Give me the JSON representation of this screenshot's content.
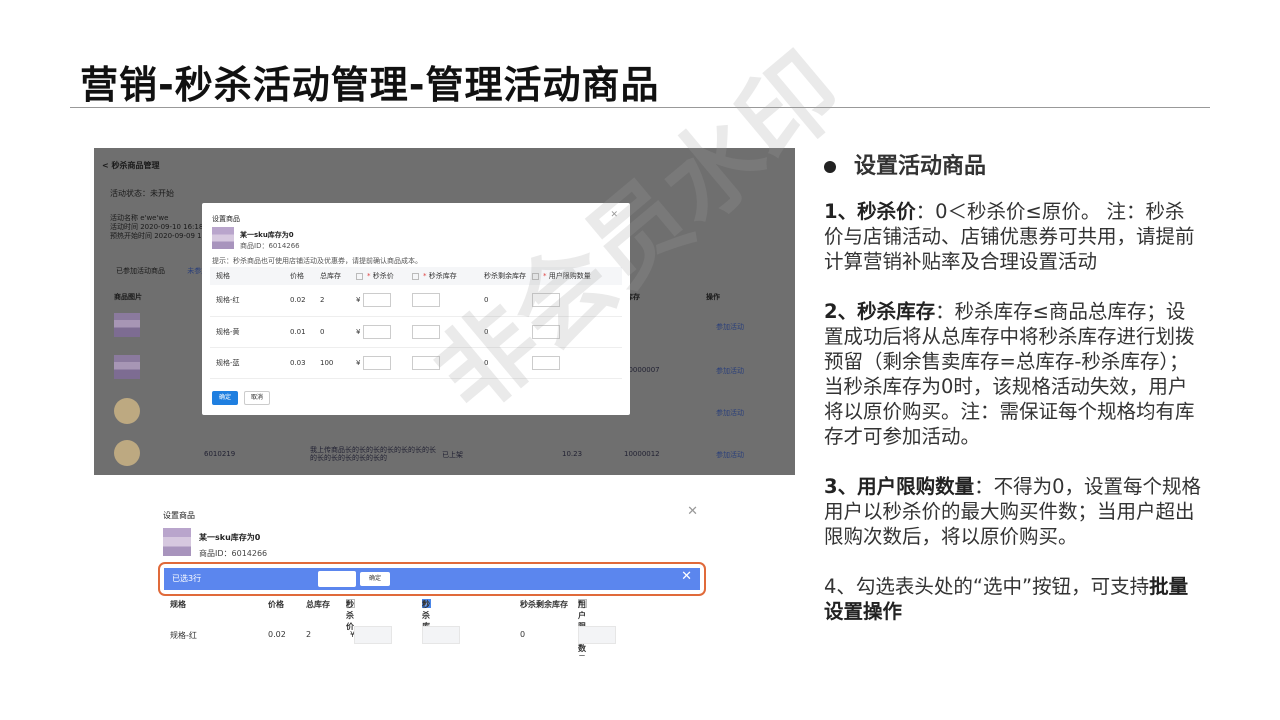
{
  "page_title": "营销-秒杀活动管理-管理活动商品",
  "watermark": "非会员水印",
  "top_screenshot": {
    "back_title": "< 秒杀商品管理",
    "status": "活动状态：未开始",
    "info": [
      "活动名称  e'we'we",
      "活动时间  2020-09-10 16:18",
      "预热开始时间  2020-09-09 16:19"
    ],
    "tabs": [
      "已参加活动商品",
      "未参加商品"
    ],
    "bg_headers": [
      "商品图片",
      "库存",
      "操作"
    ],
    "bg_rows": [
      {
        "id": "",
        "desc": "",
        "status": "",
        "price": "",
        "stock": "",
        "action": "参加活动"
      },
      {
        "id": "",
        "desc": "",
        "status": "",
        "price": "",
        "stock": "10000007",
        "action": "参加活动"
      },
      {
        "id": "",
        "desc": "",
        "status": "",
        "price": "",
        "stock": "",
        "action": "参加活动"
      },
      {
        "id": "6010219",
        "desc": "我上传商品长的长的长的长的长的长的长的长的长的长的长的长的",
        "status": "已上架",
        "price": "10.23",
        "stock": "10000012",
        "action": "参加活动"
      }
    ],
    "dialog": {
      "title": "设置商品",
      "product_name": "某一sku库存为0",
      "product_id": "商品ID：6014266",
      "tip": "提示：秒杀商品也可使用店铺活动及优惠券，请提前确认商品成本。",
      "headers": [
        "规格",
        "价格",
        "总库存",
        "秒杀价",
        "秒杀库存",
        "秒杀剩余库存",
        "用户限购数量"
      ],
      "rows": [
        {
          "spec": "规格-红",
          "price": "0.02",
          "stock": "2",
          "currency": "¥",
          "remain": "0"
        },
        {
          "spec": "规格-黄",
          "price": "0.01",
          "stock": "0",
          "currency": "¥",
          "remain": "0"
        },
        {
          "spec": "规格-蓝",
          "price": "0.03",
          "stock": "100",
          "currency": "¥",
          "remain": "0"
        }
      ],
      "ok": "确定",
      "cancel": "取消"
    }
  },
  "bottom_screenshot": {
    "title": "设置商品",
    "product_name": "某一sku库存为0",
    "product_id": "商品ID：6014266",
    "selected_count": "已选3行",
    "bar_ok": "确定",
    "headers": [
      "规格",
      "价格",
      "总库存",
      "秒杀价",
      "秒杀库存",
      "秒杀剩余库存",
      "用户限购数量"
    ],
    "row": {
      "spec": "规格-红",
      "price": "0.02",
      "stock": "2",
      "currency": "¥",
      "remain": "0"
    }
  },
  "notes": {
    "heading": "设置活动商品",
    "p1_bold": "1、秒杀价",
    "p1_text": "：0＜秒杀价≤原价。 注：秒杀价与店铺活动、店铺优惠券可共用，请提前计算营销补贴率及合理设置活动",
    "p2_bold": "2、秒杀库存",
    "p2_text": "：秒杀库存≤商品总库存；设置成功后将从总库存中将秒杀库存进行划拨预留（剩余售卖库存=总库存-秒杀库存）；当秒杀库存为0时，该规格活动失效，用户将以原价购买。注：需保证每个规格均有库存才可参加活动。",
    "p3_bold": "3、用户限购数量",
    "p3_text": "：不得为0，设置每个规格用户以秒杀价的最大购买件数；当用户超出限购次数后，将以原价购买。",
    "p4_text": "4、勾选表头处的“选中”按钮，可支持",
    "p4_bold": "批量设置操作"
  }
}
